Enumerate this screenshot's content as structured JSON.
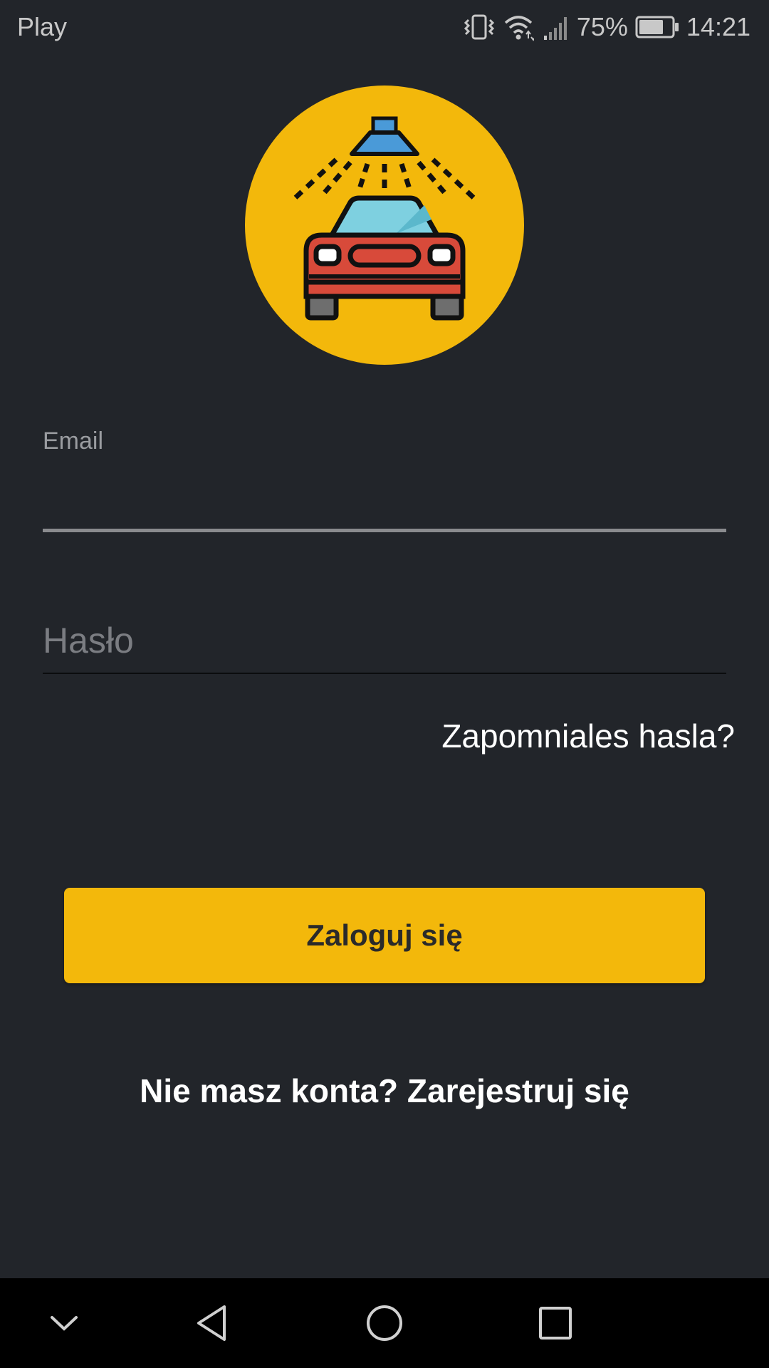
{
  "status_bar": {
    "carrier": "Play",
    "battery_percent": "75%",
    "time": "14:21",
    "icons": [
      "vibrate-icon",
      "wifi-icon",
      "signal-icon",
      "battery-icon"
    ],
    "battery_level": 0.75
  },
  "logo": {
    "icon": "car-wash-icon",
    "background_color": "#f3b80b"
  },
  "email": {
    "label": "Email",
    "value": ""
  },
  "password": {
    "placeholder": "Hasło",
    "value": ""
  },
  "forgot_password": "Zapomniales hasla?",
  "login_button": "Zaloguj się",
  "register_link": "Nie masz konta? Zarejestruj się",
  "nav_bar": {
    "icons": [
      "chevron-down-icon",
      "back-icon",
      "home-icon",
      "recents-icon"
    ]
  },
  "colors": {
    "background": "#22252a",
    "accent": "#f3b80b",
    "nav_bar": "#000000"
  }
}
